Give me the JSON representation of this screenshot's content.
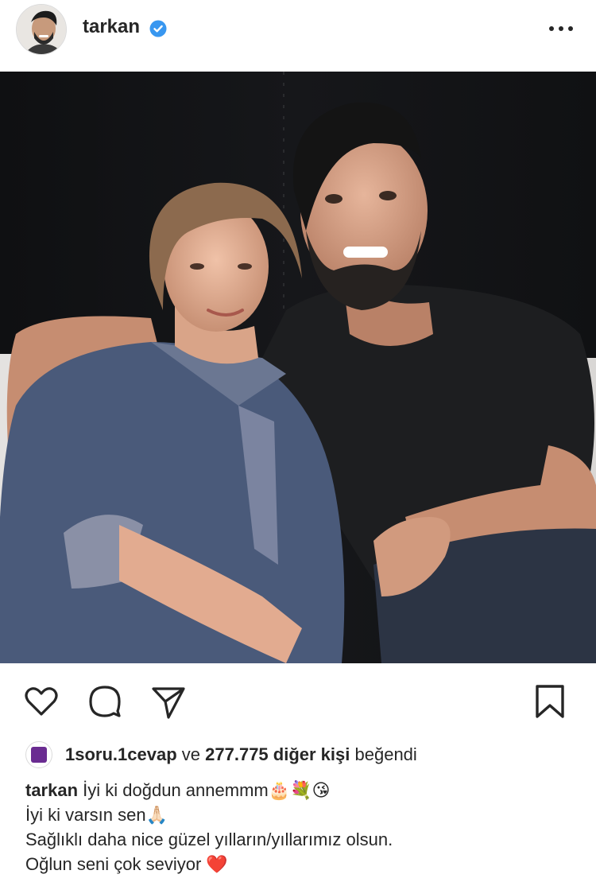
{
  "post": {
    "username": "tarkan",
    "verified": true,
    "more_icon": "more-horizontal-icon"
  },
  "actions": {
    "like_icon": "heart-icon",
    "comment_icon": "comment-icon",
    "share_icon": "send-icon",
    "save_icon": "bookmark-icon"
  },
  "likes": {
    "liker": "1soru.1cevap",
    "connector": "ve",
    "others_count": "277.775 diğer kişi",
    "suffix": "beğendi"
  },
  "caption": {
    "username": "tarkan",
    "line1": "İyi ki doğdun annemmm🎂💐😘",
    "line2": "İyi ki varsın sen🙏🏻",
    "line3": "Sağlıklı daha nice güzel yılların/yıllarımız olsun.",
    "line4": "Oğlun seni çok seviyor ❤️"
  },
  "colors": {
    "text": "#262626",
    "verified_blue": "#3897f0",
    "liker_avatar": "#6a2c91"
  }
}
